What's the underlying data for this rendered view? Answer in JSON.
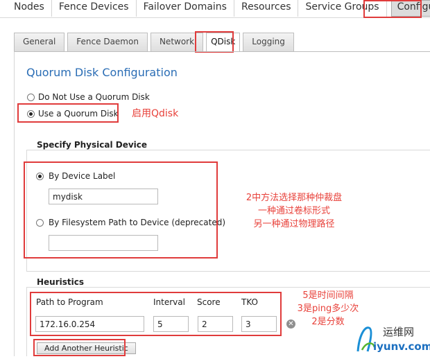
{
  "topnav": {
    "items": [
      "Nodes",
      "Fence Devices",
      "Failover Domains",
      "Resources",
      "Service Groups",
      "Configure"
    ]
  },
  "tabs": [
    "General",
    "Fence Daemon",
    "Network",
    "QDisk",
    "Logging"
  ],
  "qdisk": {
    "title": "Quorum Disk Configuration",
    "option_no": "Do Not Use a Quorum Disk",
    "option_use": "Use a Quorum Disk"
  },
  "device": {
    "legend": "Specify Physical Device",
    "by_label": "By Device Label",
    "label_value": "mydisk",
    "by_path": "By Filesystem Path to Device (deprecated)",
    "path_value": ""
  },
  "heuristics": {
    "legend": "Heuristics",
    "col_path": "Path to Program",
    "col_interval": "Interval",
    "col_score": "Score",
    "col_tko": "TKO",
    "path_value": "172.16.0.254",
    "interval_value": "5",
    "score_value": "2",
    "tko_value": "3",
    "add_button": "Add Another Heuristic"
  },
  "annotations": {
    "enable": "启用Qdisk",
    "device_line1": "2中方法选择那种仲裁盘",
    "device_line2": "一种通过卷标形式",
    "device_line3": "另一种通过物理路径",
    "heur_line1": "5是时间间隔",
    "heur_line2": "3是ping多少次",
    "heur_line3": "2是分数"
  },
  "watermark": {
    "cn": "运维网",
    "domain": "iyunv.com"
  },
  "colors": {
    "annotation_red": "#e03b3b",
    "title_blue": "#2a6db5"
  }
}
